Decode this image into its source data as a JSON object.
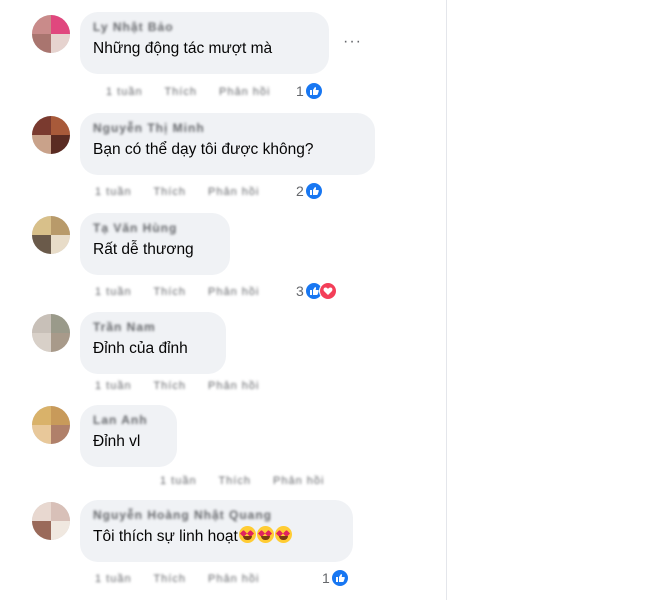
{
  "comments": [
    {
      "author": "Ly Nhật Bảo",
      "text": "Những động tác mượt mà",
      "meta": [
        "1 tuần",
        "Thích",
        "Phản hồi"
      ],
      "reaction_count": "1",
      "reactions": [
        "like-icon"
      ]
    },
    {
      "author": "Nguyễn Thị Minh",
      "text": "Bạn có thể dạy tôi được không?",
      "meta": [
        "1 tuần",
        "Thích",
        "Phản hồi"
      ],
      "reaction_count": "2",
      "reactions": [
        "like-icon"
      ]
    },
    {
      "author": "Tạ Văn Hùng",
      "text": "Rất dễ thương",
      "meta": [
        "1 tuần",
        "Thích",
        "Phản hồi"
      ],
      "reaction_count": "3",
      "reactions": [
        "like-icon",
        "love-icon"
      ]
    },
    {
      "author": "Trần Nam",
      "text": "Đỉnh của đỉnh",
      "meta": [
        "1 tuần",
        "Thích",
        "Phản hồi"
      ],
      "reaction_count": "",
      "reactions": []
    },
    {
      "author": "Lan Anh",
      "text": "Đỉnh vl",
      "meta": [
        "1 tuần",
        "Thích",
        "Phản hồi"
      ],
      "reaction_count": "",
      "reactions": []
    },
    {
      "author": "Nguyễn Hoàng Nhật Quang",
      "text": "Tôi thích sự linh hoạt",
      "meta": [
        "1 tuần",
        "Thích",
        "Phản hồi"
      ],
      "reaction_count": "1",
      "reactions": [
        "like-icon"
      ],
      "text_emojis": [
        "heart-eyes-emoji",
        "heart-eyes-emoji",
        "heart-eyes-emoji"
      ]
    }
  ],
  "more_label": "···",
  "colors": {
    "bubble": "#f0f2f5",
    "like": "#1877f2",
    "love": "#f33e58",
    "muted": "#65676b"
  }
}
